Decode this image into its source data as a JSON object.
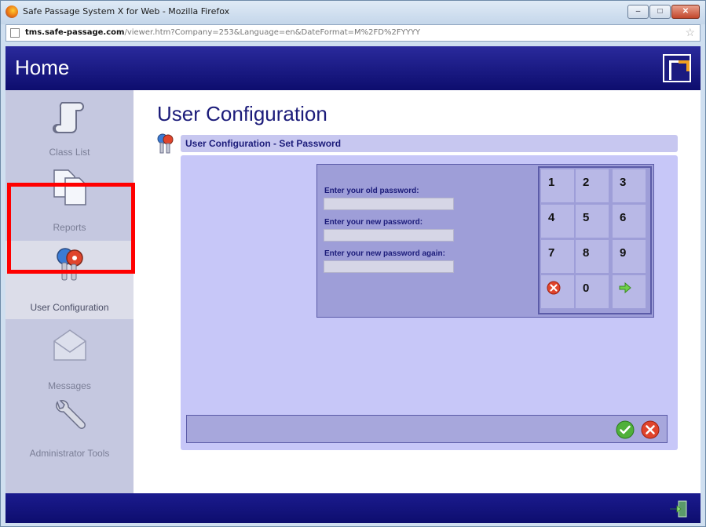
{
  "browser": {
    "title": "Safe Passage System X for Web - Mozilla Firefox",
    "url_domain": "tms.safe-passage.com",
    "url_path": "/viewer.htm?Company=253&Language=en&DateFormat=M%2FD%2FYYYY",
    "minimize": "–",
    "maximize": "□",
    "close": "✕"
  },
  "header": {
    "title": "Home"
  },
  "sidebar": {
    "items": [
      {
        "label": "Class List",
        "icon": "scroll-icon"
      },
      {
        "label": "Reports",
        "icon": "documents-icon"
      },
      {
        "label": "User Configuration",
        "icon": "keys-icon"
      },
      {
        "label": "Messages",
        "icon": "envelope-icon"
      },
      {
        "label": "Administrator Tools",
        "icon": "wrench-icon"
      }
    ]
  },
  "main": {
    "title": "User Configuration",
    "panel_title": "User Configuration - Set Password",
    "fields": {
      "old_label": "Enter your old password:",
      "new_label": "Enter your new password:",
      "again_label": "Enter your new password again:",
      "old_value": "",
      "new_value": "",
      "again_value": ""
    },
    "keypad": {
      "k1": "1",
      "k2": "2",
      "k3": "3",
      "k4": "4",
      "k5": "5",
      "k6": "6",
      "k7": "7",
      "k8": "8",
      "k9": "9",
      "k0": "0"
    }
  },
  "colors": {
    "header": "#1c1c84",
    "sidebar": "#c5c8e0",
    "panel": "#c7c7f8",
    "accent": "#1c1c7a",
    "highlight": "#ff0000"
  }
}
